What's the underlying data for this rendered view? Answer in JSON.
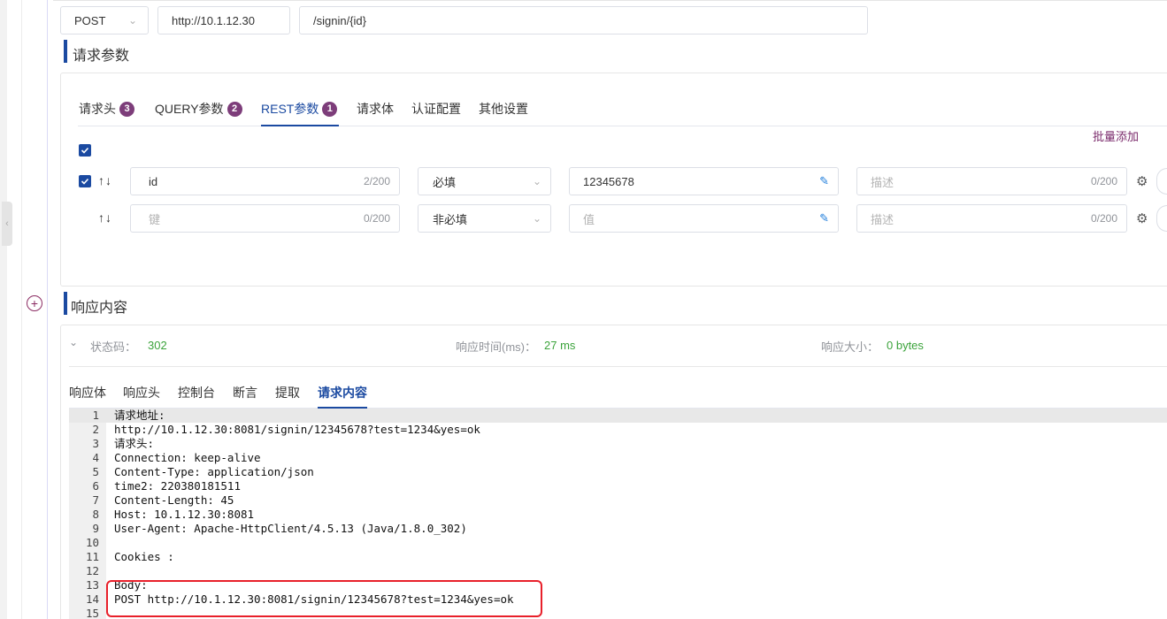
{
  "request": {
    "method": "POST",
    "host": "http://10.1.12.30",
    "path": "/signin/{id}"
  },
  "params_section": {
    "title": "请求参数"
  },
  "param_tabs": [
    {
      "label": "请求头",
      "badge": "3"
    },
    {
      "label": "QUERY参数",
      "badge": "2"
    },
    {
      "label": "REST参数",
      "badge": "1"
    },
    {
      "label": "请求体"
    },
    {
      "label": "认证配置"
    },
    {
      "label": "其他设置"
    }
  ],
  "batch_add": "批量添加",
  "rows": [
    {
      "key": "id",
      "key_count": "2/200",
      "required": "必填",
      "value": "12345678",
      "desc_placeholder": "描述",
      "desc_count": "0/200"
    },
    {
      "key_placeholder": "键",
      "key_count": "0/200",
      "required": "非必填",
      "value_placeholder": "值",
      "desc_placeholder": "描述",
      "desc_count": "0/200"
    }
  ],
  "response_section": {
    "title": "响应内容"
  },
  "stats": {
    "status_label": "状态码：",
    "status_value": "302",
    "time_label": "响应时间(ms)：",
    "time_value": "27 ms",
    "size_label": "响应大小：",
    "size_value": "0 bytes"
  },
  "response_tabs": [
    "响应体",
    "响应头",
    "控制台",
    "断言",
    "提取",
    "请求内容"
  ],
  "code_lines": [
    {
      "n": "1",
      "t": "请求地址:"
    },
    {
      "n": "2",
      "t": "http://10.1.12.30:8081/signin/12345678?test=1234&yes=ok"
    },
    {
      "n": "3",
      "t": "请求头:"
    },
    {
      "n": "4",
      "t": "Connection: keep-alive"
    },
    {
      "n": "5",
      "t": "Content-Type: application/json"
    },
    {
      "n": "6",
      "t": "time2: 220380181511"
    },
    {
      "n": "7",
      "t": "Content-Length: 45"
    },
    {
      "n": "8",
      "t": "Host: 10.1.12.30:8081"
    },
    {
      "n": "9",
      "t": "User-Agent: Apache-HttpClient/4.5.13 (Java/1.8.0_302)"
    },
    {
      "n": "10",
      "t": ""
    },
    {
      "n": "11",
      "t": "Cookies :"
    },
    {
      "n": "12",
      "t": ""
    },
    {
      "n": "13",
      "t": "Body:"
    },
    {
      "n": "14",
      "t": "POST http://10.1.12.30:8081/signin/12345678?test=1234&yes=ok"
    },
    {
      "n": "15",
      "t": ""
    }
  ],
  "colors": {
    "accent": "#1b4aa1",
    "badge": "#7d3d7a",
    "success": "#3ba33b",
    "highlight": "#e8202a"
  }
}
